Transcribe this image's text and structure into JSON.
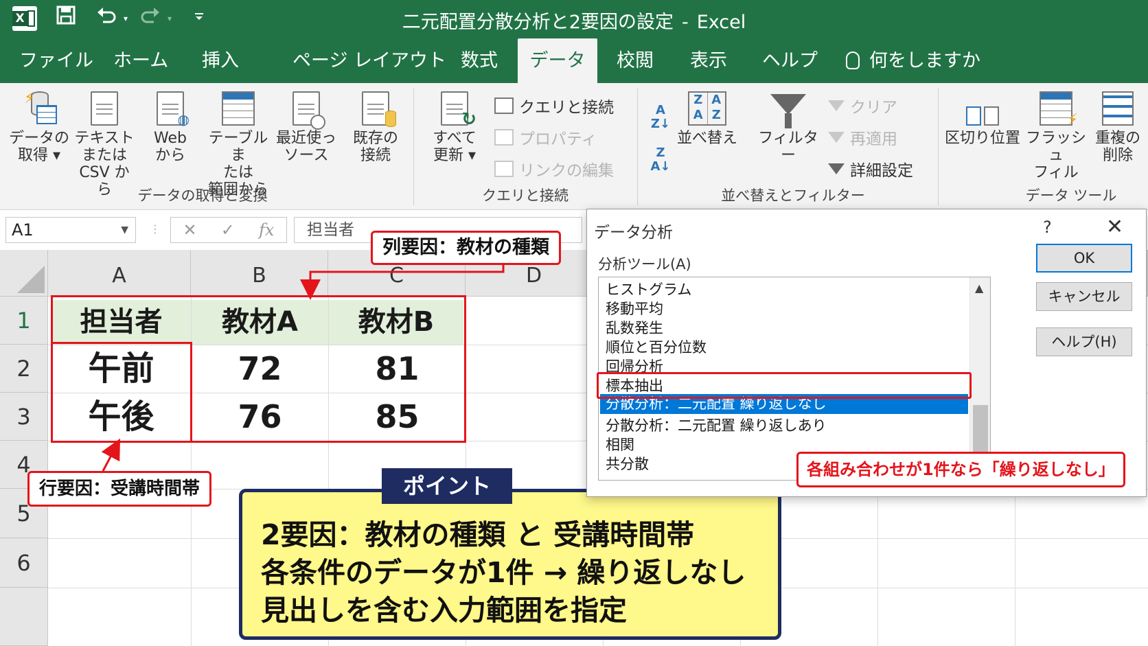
{
  "window": {
    "title": "二元配置分散分析と2要因の設定",
    "separator": "-",
    "app": "Excel"
  },
  "quick_access": {
    "logo_icon": "excel-logo-icon",
    "save_icon": "save-icon",
    "undo_icon": "undo-icon",
    "redo_icon": "redo-icon",
    "customize_icon": "customize-qat-icon"
  },
  "tabs": [
    {
      "label": "ファイル"
    },
    {
      "label": "ホーム"
    },
    {
      "label": "挿入"
    },
    {
      "label": "ページ レイアウト"
    },
    {
      "label": "数式"
    },
    {
      "label": "データ",
      "active": true
    },
    {
      "label": "校閲"
    },
    {
      "label": "表示"
    },
    {
      "label": "ヘルプ"
    }
  ],
  "tell_me": "何をしますか",
  "ribbon": {
    "get_data": "データの\n取得 ▾",
    "text_csv": "テキスト\nまたは\nCSV から",
    "web": "Web\nから",
    "from_table": "テーブルま\nたは\n範囲から",
    "recent_sources": "最近使っ\nソース",
    "existing_conn": "既存の\n接続",
    "group1": "データの取得と変換",
    "refresh_all": "すべて\n更新 ▾",
    "queries_conn": "クエリと接続",
    "properties": "プロパティ",
    "edit_links": "リンクの編集",
    "group2": "クエリと接続",
    "sort": "並べ替え",
    "filter": "フィルター",
    "clear": "クリア",
    "reapply": "再適用",
    "advanced": "詳細設定",
    "group3": "並べ替えとフィルター",
    "text_to_columns": "区切り位置",
    "flash_fill": "フラッシュ\nフィル",
    "remove_dup": "重複の\n削除",
    "group4": "データ ツール"
  },
  "formula_bar": {
    "name_box": "A1",
    "fx": "fx",
    "content": "担当者"
  },
  "sheet": {
    "columns": [
      "A",
      "B",
      "C",
      "D"
    ],
    "rows": [
      "1",
      "2",
      "3",
      "4",
      "5",
      "6"
    ],
    "header": [
      "担当者",
      "教材A",
      "教材B"
    ],
    "data": [
      [
        "午前",
        "72",
        "81"
      ],
      [
        "午後",
        "76",
        "85"
      ]
    ]
  },
  "callouts": {
    "column_factor": "列要因：教材の種類",
    "row_factor": "行要因：受講時間帯",
    "no_repeat_hint": "各組み合わせが1件なら「繰り返しなし」"
  },
  "point": {
    "label": "ポイント",
    "lines": [
      "2要因：教材の種類 と 受講時間帯",
      "各条件のデータが1件 → 繰り返しなし",
      "見出しを含む入力範囲を指定"
    ]
  },
  "dialog": {
    "title": "データ分析",
    "help": "?",
    "close": "✕",
    "tools_label": "分析ツール(A)",
    "items": [
      "ヒストグラム",
      "移動平均",
      "乱数発生",
      "順位と百分位数",
      "回帰分析",
      "標本抽出",
      "分散分析：二元配置 繰り返しなし",
      "分散分析：二元配置 繰り返しあり",
      "相関",
      "共分散"
    ],
    "selected_index": 6,
    "ok": "OK",
    "cancel": "キャンセル",
    "help_btn": "ヘルプ(H)"
  },
  "colors": {
    "excel_green": "#217346",
    "highlight_red": "#e4141b",
    "selection_blue": "#0078d7",
    "point_navy": "#1e2c62",
    "point_yellow": "#fff88a",
    "header_fill": "#e2efda"
  }
}
